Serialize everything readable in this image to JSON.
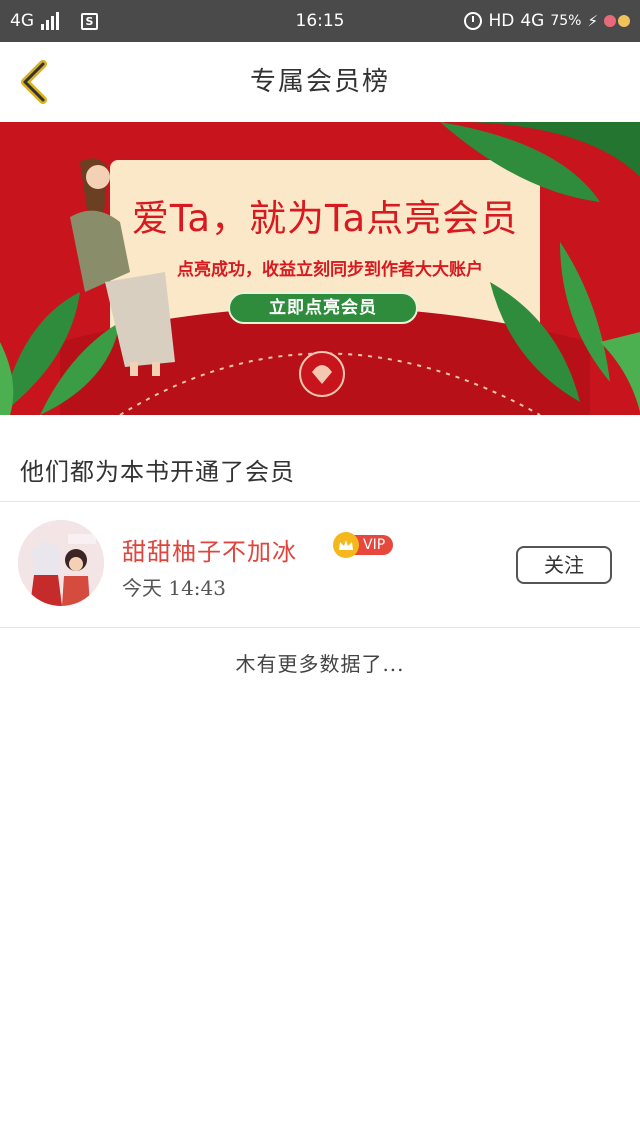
{
  "status_bar": {
    "network": "4G",
    "time": "16:15",
    "hd": "HD",
    "network_right": "4G",
    "battery": "75%",
    "bolt": "⚡"
  },
  "header": {
    "title": "专属会员榜"
  },
  "banner": {
    "title": "爱Ta，就为Ta点亮会员",
    "subtitle": "点亮成功，收益立刻同步到作者大大账户",
    "cta": "立即点亮会员",
    "colors": {
      "background": "#c8141c",
      "card": "#fbe8c8",
      "leaf": "#2f8c3c",
      "text": "#d8191f"
    }
  },
  "section": {
    "title": "他们都为本书开通了会员"
  },
  "members": [
    {
      "name": "甜甜柚子不加冰",
      "vip": "VIP",
      "time": "今天 14:43",
      "follow_label": "关注"
    }
  ],
  "footer": {
    "no_more": "木有更多数据了..."
  },
  "colors": {
    "accent_red": "#e0453d",
    "vip_gold": "#f5b81c",
    "status_bar": "#4a4a4a"
  }
}
